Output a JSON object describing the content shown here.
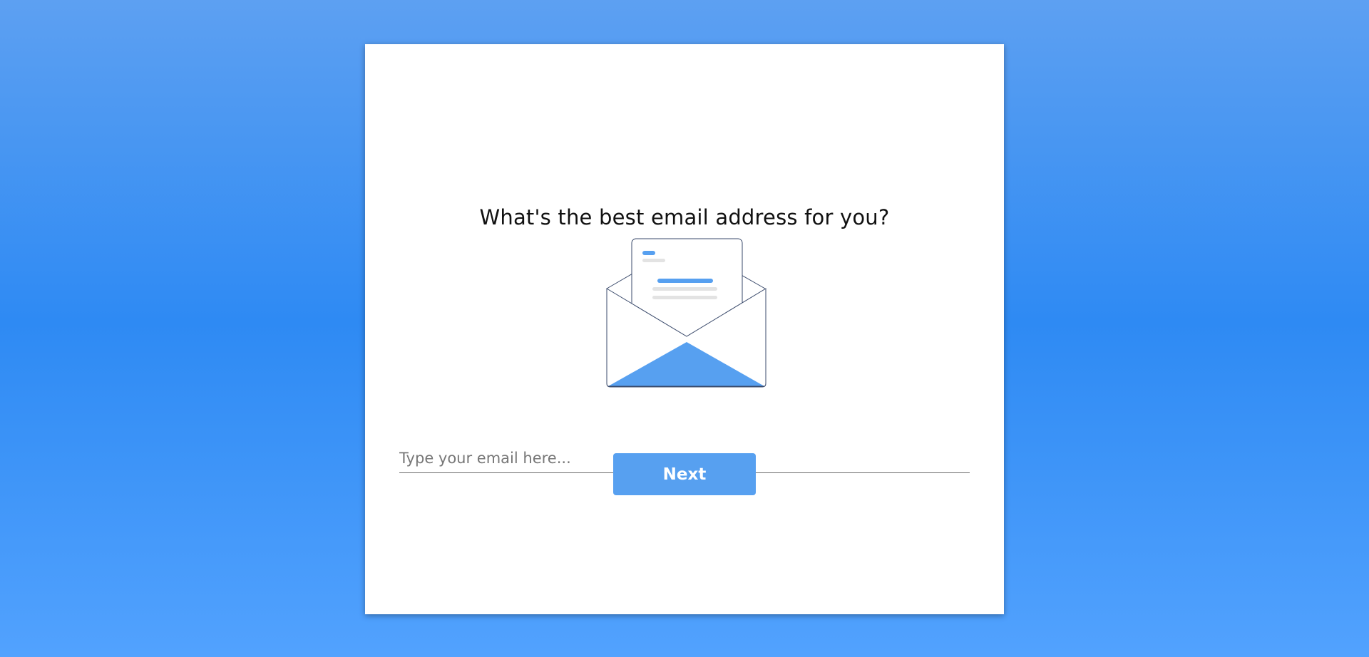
{
  "form": {
    "title": "What's the best email address for you?",
    "email_placeholder": "Type your email here...",
    "email_value": "",
    "next_label": "Next"
  },
  "illustration": {
    "icon": "envelope-letter-icon",
    "accent_color": "#57a0f0",
    "line_color": "#3a4a6b",
    "placeholder_line_color": "#e3e3e3"
  },
  "theme": {
    "background_top": "#5da0f2",
    "background_mid": "#2e8af3",
    "background_bottom": "#52a2fe",
    "card_background": "#ffffff",
    "button_color": "#57a0f0"
  }
}
